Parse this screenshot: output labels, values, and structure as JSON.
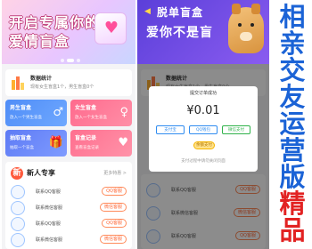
{
  "left": {
    "banner": {
      "line1": "开启专属你的",
      "line2": "爱情盲盒"
    },
    "stats": {
      "title": "数据统计",
      "subtitle": "现有女生盲盒1个，男生盲盒0个"
    },
    "tiles": [
      {
        "title": "男生盲盒",
        "sub": "放入一个男生盲盒"
      },
      {
        "title": "女生盲盒",
        "sub": "放入一个女生盲盒"
      },
      {
        "title": "抽取盲盒",
        "sub": "抽取一个盲盒"
      },
      {
        "title": "盲盒记录",
        "sub": "查看盲盒记录"
      }
    ],
    "newuser": {
      "title": "新人专享",
      "more": "更多特惠 >",
      "rows": [
        {
          "name": "联系QQ客服",
          "button": "QQ客服"
        },
        {
          "name": "联系微信客服",
          "button": "微信客服"
        },
        {
          "name": "联系QQ客服",
          "button": "QQ客服"
        },
        {
          "name": "联系微信客服",
          "button": "微信客服"
        }
      ]
    }
  },
  "mid": {
    "banner": {
      "line1": "脱单盲盒",
      "line2": "爱你不是盲"
    },
    "stats": {
      "title": "数据统计",
      "subtitle": "现有女生盲盒1个，男生盲盒0个"
    },
    "modal": {
      "title": "提交订单成功",
      "price": "¥0.01",
      "pay_alipay": "支付宝",
      "pay_qq": "QQ钱包",
      "pay_wechat": "微信支付",
      "free": "余额支付",
      "foot": "支付过程中请勿关闭页面"
    },
    "rows": [
      {
        "name": "联系QQ客服",
        "button": "QQ客服"
      },
      {
        "name": "联系微信客服",
        "button": "微信客服"
      },
      {
        "name": "联系QQ客服",
        "button": "QQ客服"
      }
    ]
  },
  "side": {
    "blue_chars": [
      "相",
      "亲",
      "交",
      "友",
      "运",
      "营",
      "版"
    ],
    "red_chars": [
      "精",
      "品"
    ]
  },
  "colors": {
    "blue": "#1b63d6",
    "red": "#e22222",
    "accent_pink": "#ff6a8d",
    "accent_blue": "#4f8df7"
  }
}
